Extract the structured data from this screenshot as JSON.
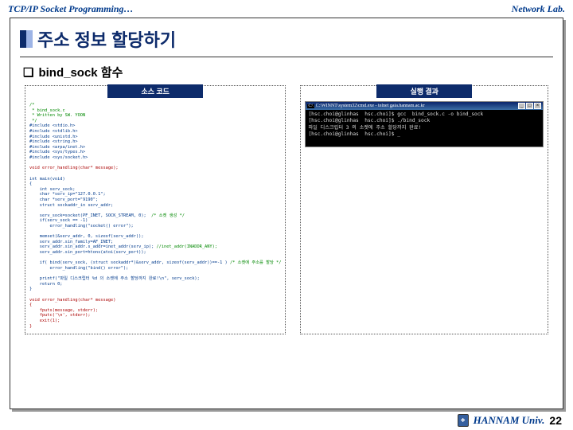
{
  "header": {
    "left": "TCP/IP Socket Programming…",
    "right": "Network Lab."
  },
  "slide": {
    "title": "주소 정보 할당하기",
    "subtitle": "bind_sock 함수",
    "left_tab": "소스 코드",
    "right_tab": "실행 결과"
  },
  "code": {
    "c1": "/*",
    "c2": " * bind_sock.c",
    "c3": " * Written by SW. YOON",
    "c4": " */",
    "i1": "#include <stdio.h>",
    "i2": "#include <stdlib.h>",
    "i3": "#include <unistd.h>",
    "i4": "#include <string.h>",
    "i5": "#include <arpa/inet.h>",
    "i6": "#include <sys/types.h>",
    "i7": "#include <sys/socket.h>",
    "proto": "void error_handling(char* message);",
    "main": "int main(void)",
    "ob": "{",
    "d1": "    int serv_sock;",
    "d2": "    char *serv_ip=\"127.0.0.1\";",
    "d3": "    char *serv_port=\"9190\";",
    "d4": "    struct sockaddr_in serv_addr;",
    "s1": "    serv_sock=socket(PF_INET, SOCK_STREAM, 0);",
    "s1c": "  /* 소켓 생성 */",
    "s2": "    if(serv_sock == -1)",
    "s3": "        error_handling(\"socket() error\");",
    "m1": "    memset(&serv_addr, 0, sizeof(serv_addr));",
    "m2": "    serv_addr.sin_family=AF_INET;",
    "m3": "    serv_addr.sin_addr.s_addr=inet_addr(serv_ip);",
    "m3c": " //inet_addr(INADDR_ANY);",
    "m4": "    serv_addr.sin_port=htons(atoi(serv_port));",
    "b1": "    if( bind(serv_sock, (struct sockaddr*)&serv_addr, sizeof(serv_addr))==-1 )",
    "b1c": " /* 소켓에 주소를 할당 */",
    "b2": "        error_handling(\"bind() error\");",
    "p1": "    printf(\"파일 디스크립터 %d 의 소켓에 주소 할당까지 완료!\\n\", serv_sock);",
    "p2": "    return 0;",
    "cb": "}",
    "eh1": "void error_handling(char* message)",
    "eh2": "{",
    "eh3": "    fputs(message, stderr);",
    "eh4": "    fputc('\\n', stderr);",
    "eh5": "    exit(1);",
    "eh6": "}"
  },
  "terminal": {
    "title": " C:\\WINNT\\system32\\cmd.exe - telnet gaia.hannam.ac.kr",
    "icon_glyph": "C:\\",
    "btn_min": "_",
    "btn_max": "□",
    "btn_close": "×",
    "l1": "[hsc.choi@glinhas  hsc.choi]$ gcc  bind_sock.c -o bind_sock",
    "l2": "[hsc.choi@glinhas  hsc.choi]$ ./bind_sock",
    "l3": "파일 디스크립터 3 의 소켓에 주소 할당까지 완료!",
    "l4": "[hsc.choi@glinhas  hsc.choi]$ _"
  },
  "footer": {
    "univ": "HANNAM Univ.",
    "page": "22",
    "logo_glyph": "❖"
  }
}
